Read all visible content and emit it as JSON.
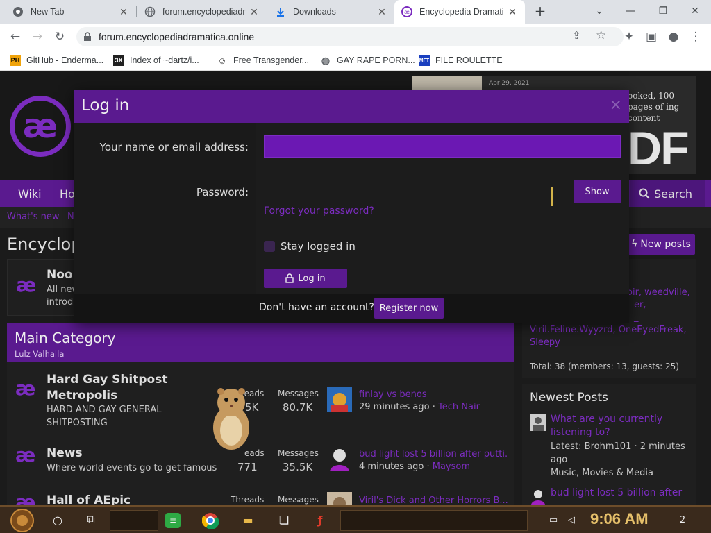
{
  "browser": {
    "tabs": [
      {
        "title": "New Tab",
        "icon": "chrome-icon"
      },
      {
        "title": "forum.encyclopediadr",
        "icon": "globe-icon"
      },
      {
        "title": "Downloads",
        "icon": "download-icon"
      },
      {
        "title": "Encyclopedia Dramati",
        "icon": "ae-icon",
        "active": true
      }
    ],
    "url": "forum.encyclopediadramatica.online",
    "bookmarks": [
      {
        "label": "GitHub - Enderma...",
        "icon": "PH"
      },
      {
        "label": "Index of ~dartz/i...",
        "icon": "3X"
      },
      {
        "label": "Free Transgender...",
        "icon": "mask"
      },
      {
        "label": "GAY RAPE PORN...",
        "icon": "globe"
      },
      {
        "label": "FILE ROULETTE",
        "icon": "MFT"
      }
    ]
  },
  "site": {
    "banner_date": "Apr 29, 2021",
    "banner_text": "ooked, 100 pages of ing content",
    "banner_big": "DF",
    "nav": [
      "Wiki",
      "Ho"
    ],
    "search": "Search",
    "subnav": [
      "What's new",
      "N"
    ],
    "page_title": "Encyclop",
    "new_posts": "New posts",
    "noob": {
      "title": "Noob",
      "desc1": "All new",
      "desc2": "introd"
    },
    "main_category": {
      "title": "Main Category",
      "subtitle": "Lulz Valhalla"
    },
    "forums": [
      {
        "title1": "Hard Gay Shitpost",
        "title2": "Metropolis",
        "desc1": "HARD AND GAY GENERAL",
        "desc2": "SHITPOSTING",
        "threads_label": "Threads",
        "threads": "5K",
        "messages_label": "Messages",
        "messages": "80.7K",
        "last_title": "finlay vs benos",
        "last_time": "29 minutes ago",
        "last_user": "Tech Nair"
      },
      {
        "title1": "News",
        "desc1": "Where world events go to get famous",
        "threads_label": "eads",
        "threads": "771",
        "messages_label": "Messages",
        "messages": "35.5K",
        "last_title": "bud light lost 5 billion after putti...",
        "last_time": "4 minutes ago",
        "last_user": "Maysom"
      },
      {
        "title1": "Hall of AEpic",
        "threads_label": "Threads",
        "messages_label": "Messages",
        "last_title": "Viril's Dick and Other Horrors B..."
      }
    ],
    "online": {
      "names1": "oir, weedville,",
      "names2": "er,",
      "names3": "_",
      "names4": "Viril.Feline.Wyyzrd, OneEyedFreak,",
      "names5": "Sleepy",
      "total": "Total: 38 (members: 13, guests: 25)"
    },
    "newest": {
      "heading": "Newest Posts",
      "post1_title1": "What are you currently",
      "post1_title2": "listening to?",
      "post1_meta1": "Latest: Brohm101 · 2 minutes",
      "post1_meta2": "ago",
      "post1_meta3": "Music, Movies & Media",
      "post2_title": "bud light lost 5 billion after"
    }
  },
  "modal": {
    "title": "Log in",
    "close": "×",
    "name_label": "Your name or email address:",
    "name_value": "",
    "password_label": "Password:",
    "show": "Show",
    "forgot": "Forgot your password?",
    "stay_logged_in": "Stay logged in",
    "login_button": "Log in",
    "no_account": "Don't have an account?",
    "register": "Register now"
  },
  "taskbar": {
    "clock": "9:06 AM",
    "notification_count": "2"
  },
  "colors": {
    "accent": "#5a1a8f",
    "link": "#7b2cbf",
    "clock": "#e6c06a"
  }
}
